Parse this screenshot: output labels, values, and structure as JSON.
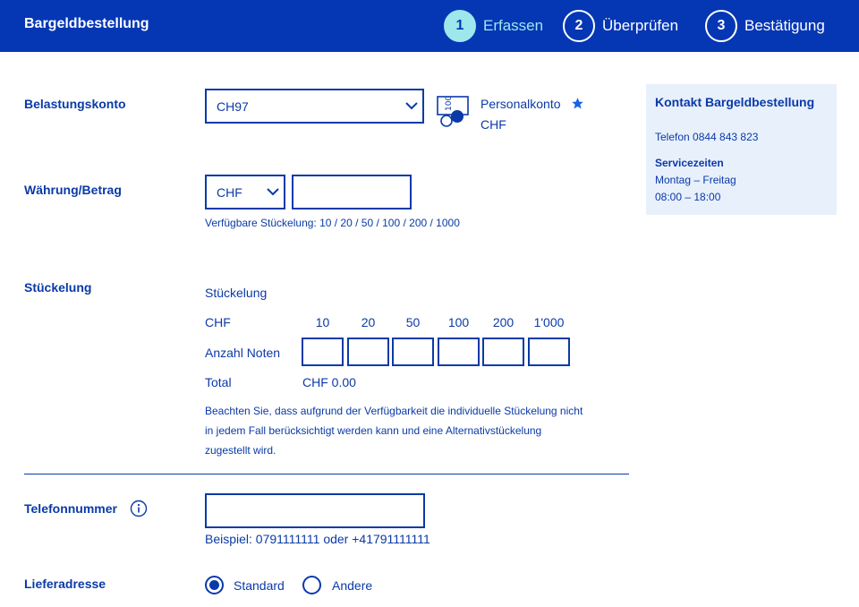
{
  "header": {
    "title": "Bargeldbestellung",
    "steps": [
      {
        "number": "1",
        "label": "Erfassen",
        "active": true
      },
      {
        "number": "2",
        "label": "Überprüfen",
        "active": false
      },
      {
        "number": "3",
        "label": "Bestätigung",
        "active": false
      }
    ]
  },
  "form": {
    "account": {
      "label": "Belastungskonto",
      "value": "CH97",
      "type_name": "Personalkonto",
      "currency": "CHF",
      "icon": "account-card-icon",
      "favorite_icon": "star-icon"
    },
    "amount": {
      "label": "Währung/Betrag",
      "currency": "CHF",
      "value": "",
      "hint": "Verfügbare Stückelung: 10 / 20 / 50 / 100 / 200 / 1000"
    },
    "denomination": {
      "label": "Stückelung",
      "heading": "Stückelung",
      "currency_label": "CHF",
      "values": [
        "10",
        "20",
        "50",
        "100",
        "200",
        "1'000"
      ],
      "count_label": "Anzahl Noten",
      "counts": [
        "",
        "",
        "",
        "",
        "",
        ""
      ],
      "total_label": "Total",
      "total_value": "CHF 0.00",
      "note": "Beachten Sie, dass aufgrund der Verfügbarkeit die individuelle Stückelung nicht in jedem Fall berücksichtigt werden kann und eine Alternativstückelung zugestellt wird.",
      "note_lines": [
        "Beachten Sie, dass aufgrund der Verfügbarkeit die individuelle Stückelung nicht",
        "in jedem Fall berücksichtigt werden kann und eine Alternativstückelung",
        "zugestellt wird."
      ]
    },
    "phone": {
      "label": "Telefonnummer",
      "value": "",
      "example": "Beispiel: 0791111111 oder +41791111111",
      "info_icon": "info-icon"
    },
    "delivery": {
      "label": "Lieferadresse",
      "options": [
        {
          "label": "Standard",
          "selected": true
        },
        {
          "label": "Andere",
          "selected": false
        }
      ]
    }
  },
  "contact": {
    "title": "Kontakt Bargeldbestellung",
    "phone": "Telefon 0844 843 823",
    "service_title": "Servicezeiten",
    "days": "Montag – Freitag",
    "hours": "08:00 – 18:00"
  },
  "colors": {
    "header_bg": "#0537b4",
    "primary_text": "#0a3aa8",
    "active_step": "#9ee7ec",
    "side_bg": "#e8f0fc"
  }
}
